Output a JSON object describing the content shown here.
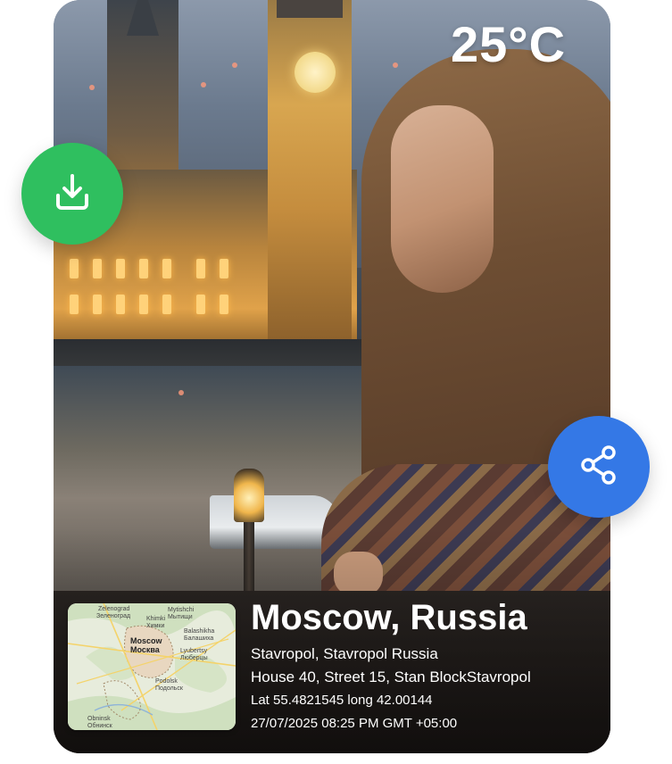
{
  "overlay": {
    "temperature": "25°C"
  },
  "actions": {
    "download_icon": "download-icon",
    "share_icon": "share-icon",
    "download_color": "#2fbf5f",
    "share_color": "#3478e6"
  },
  "location": {
    "city": "Moscow, Russia",
    "region": "Stavropol, Stavropol Russia",
    "address": "House 40, Street 15, Stan BlockStavropol",
    "coordinates": "Lat 55.4821545 long 42.00144",
    "datetime": "27/07/2025 08:25 PM GMT +05:00"
  },
  "map": {
    "labels": {
      "zelenograd": "Zelenograd",
      "zelenograd_ru": "Зеленоград",
      "mytishchi": "Mytishchi",
      "mytishchi_ru": "Мытищи",
      "khimki": "Khimki",
      "khimki_ru": "Химки",
      "balashikha": "Balashikha",
      "balashikha_ru": "Балашиха",
      "moscow": "Moscow",
      "moscow_ru": "Москва",
      "lyubertsy": "Lyubertsy",
      "lyubertsy_ru": "Люберцы",
      "podolsk": "Podolsk",
      "podolsk_ru": "Подольск",
      "obninsk": "Obninsk",
      "obninsk_ru": "Обнинск"
    }
  }
}
